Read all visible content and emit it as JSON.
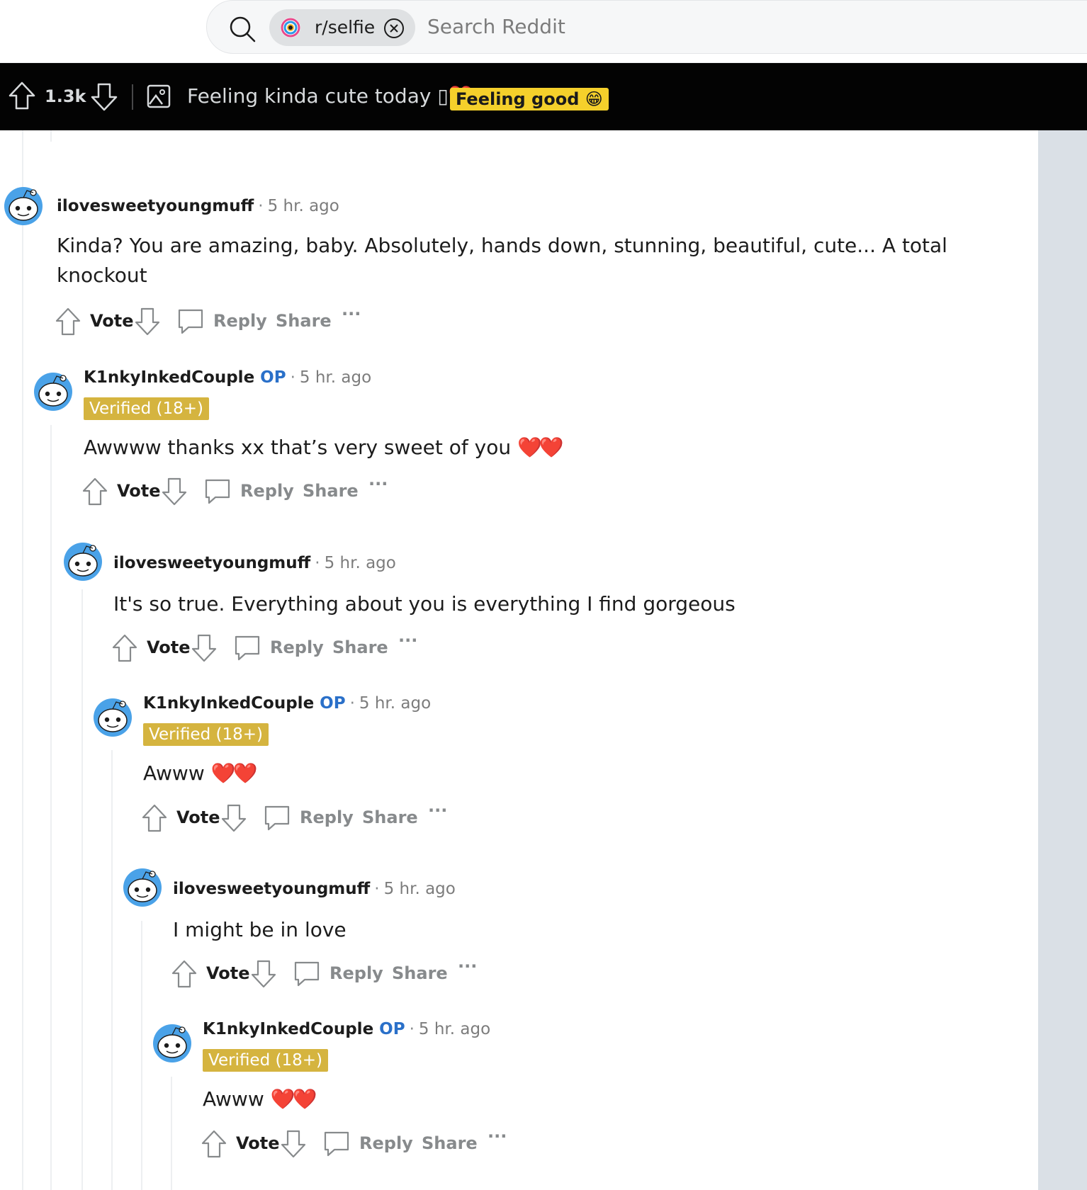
{
  "search": {
    "community_chip": "r/selfie",
    "placeholder": "Search Reddit"
  },
  "post_bar": {
    "score": "1.3k",
    "title": "Feeling kinda cute today ▯❤️",
    "flair": "Feeling good 😁"
  },
  "actions": {
    "vote": "Vote",
    "reply": "Reply",
    "share": "Share",
    "more": "···"
  },
  "comments": [
    {
      "author": "ilovesweetyoungmuff",
      "op": "",
      "time": "5 hr. ago",
      "flair": "",
      "body_line1": "Kinda? You are amazing, baby. Absolutely, hands down, stunning, beautiful, cute... A total",
      "body_line2": "knockout"
    },
    {
      "author": "K1nkyInkedCouple",
      "op": "OP",
      "time": "5 hr. ago",
      "flair": "Verified (18+)",
      "body_line1": "Awwww thanks xx that’s very sweet of you",
      "emoji": "❤️❤️"
    },
    {
      "author": "ilovesweetyoungmuff",
      "op": "",
      "time": "5 hr. ago",
      "flair": "",
      "body_line1": "It's so true. Everything about you is everything I find gorgeous"
    },
    {
      "author": "K1nkyInkedCouple",
      "op": "OP",
      "time": "5 hr. ago",
      "flair": "Verified (18+)",
      "body_line1": "Awww",
      "emoji": "❤️❤️"
    },
    {
      "author": "ilovesweetyoungmuff",
      "op": "",
      "time": "5 hr. ago",
      "flair": "",
      "body_line1": "I might be in love"
    },
    {
      "author": "K1nkyInkedCouple",
      "op": "OP",
      "time": "5 hr. ago",
      "flair": "Verified (18+)",
      "body_line1": "Awww",
      "emoji": "❤️❤️"
    }
  ],
  "colors": {
    "post_bar_bg": "#030303",
    "flair_yellow": "#f5d02b",
    "verified_flair": "#d5b43f",
    "op_blue": "#2a70c9",
    "gutter": "#dae0e6"
  }
}
